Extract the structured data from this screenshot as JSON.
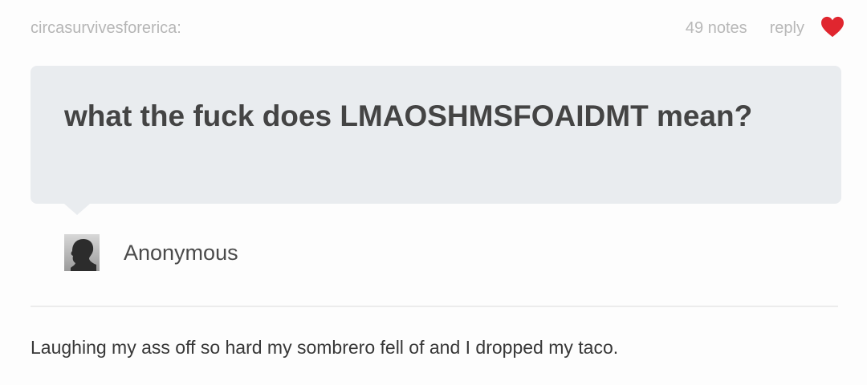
{
  "header": {
    "username": "circasurvivesforerica:",
    "notes": "49 notes",
    "reply": "reply",
    "like_icon": "heart-icon",
    "like_color": "#e0262f"
  },
  "question": {
    "text": "what the fuck does LMAOSHMSFOAIDMT mean?",
    "bubble_color": "#e9ecef"
  },
  "asker": {
    "name": "Anonymous",
    "avatar_icon": "anonymous-avatar-icon"
  },
  "answer": {
    "text": "Laughing my ass off so hard my sombrero fell of and I dropped my taco."
  }
}
